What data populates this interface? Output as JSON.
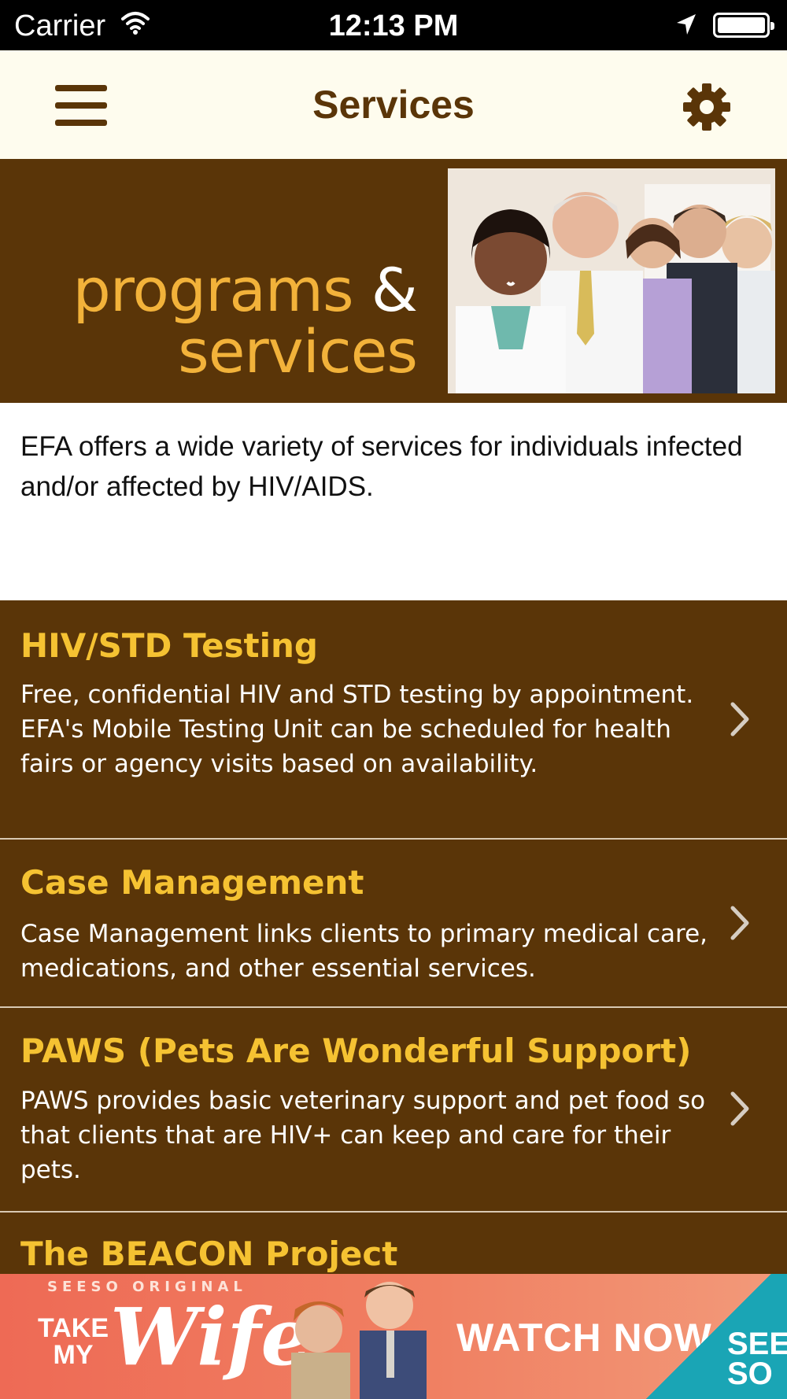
{
  "status_bar": {
    "carrier": "Carrier",
    "time": "12:13 PM"
  },
  "nav": {
    "title": "Services",
    "menu_icon": "hamburger-menu-icon",
    "settings_icon": "gear-icon"
  },
  "banner": {
    "line1": "programs",
    "amp": "&",
    "line2": "services"
  },
  "intro": "EFA offers a wide variety of services for individuals infected and/or affected by HIV/AIDS.",
  "services": [
    {
      "title": "HIV/STD Testing",
      "description": "Free, confidential HIV and STD testing by appointment.  EFA's Mobile Testing Unit can be scheduled for health fairs or agency visits based on availability."
    },
    {
      "title": "Case Management",
      "description": "Case Management links clients to primary medical care, medications, and other essential services."
    },
    {
      "title": "PAWS (Pets Are Wonderful Support)",
      "description": "PAWS provides basic veterinary support and pet food so that clients that are HIV+ can keep and care for their pets."
    },
    {
      "title": "The BEACON Project",
      "description": ""
    }
  ],
  "ad": {
    "tag": "SEESO ORIGINAL",
    "take": "TAKE",
    "my": "MY",
    "wife": "Wife",
    "cta": "WATCH NOW",
    "brand_top": "SEE",
    "brand_bottom": "SO"
  },
  "colors": {
    "brown": "#5a3508",
    "gold": "#f5c232",
    "nav_bg": "#fefcee"
  }
}
